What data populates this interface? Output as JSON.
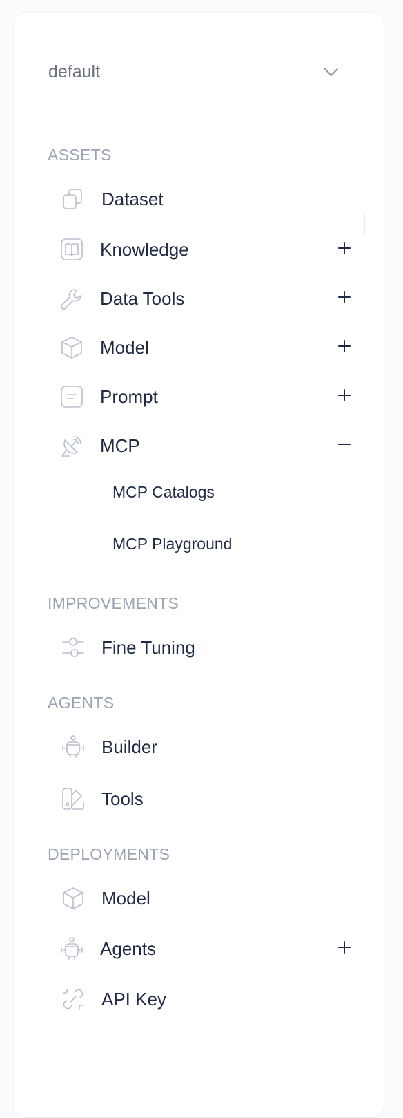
{
  "workspace": {
    "label": "default",
    "icon": "chevron-down-icon"
  },
  "sections": {
    "assets": "ASSETS",
    "improvements": "IMPROVEMENTS",
    "agents": "AGENTS",
    "deployments": "DEPLOYMENTS"
  },
  "assets": {
    "dataset": "Dataset",
    "knowledge": "Knowledge",
    "data_tools": "Data Tools",
    "model": "Model",
    "prompt": "Prompt",
    "mcp": "MCP",
    "mcp_children": [
      "MCP Catalogs",
      "MCP Playground"
    ]
  },
  "improvements": {
    "fine_tuning": "Fine Tuning"
  },
  "agents": {
    "builder": "Builder",
    "tools": "Tools"
  },
  "deployments": {
    "model": "Model",
    "agents": "Agents",
    "api_key": "API Key"
  },
  "colors": {
    "text": "#1f2a44",
    "section": "#9ba3b2",
    "icon": "#b8bfcc"
  }
}
